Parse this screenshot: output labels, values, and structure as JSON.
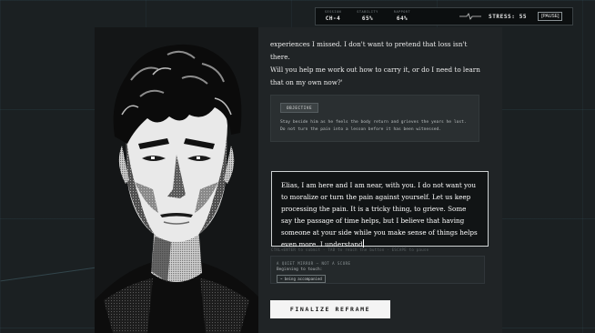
{
  "hud": {
    "session_label": "SESSION",
    "session_value": "CH-4",
    "stability_label": "STABILITY",
    "stability_value": "65%",
    "rapport_label": "RAPPORT",
    "rapport_value": "64%",
    "stress_label": "STRESS: 55",
    "pause_label": "[PAUSE]",
    "pulse_icon": "heartbeat-icon"
  },
  "story": {
    "lines": [
      "experiences I missed. I don't want to pretend that loss isn't there.",
      "Will you help me work out how to carry it, or do I need to learn",
      "that on my own now?'"
    ]
  },
  "objective": {
    "tag": "OBJECTIVE",
    "text": "Stay beside him as he feels the body return and grieves the years he lost. Do not turn the pain into a lesson before it has been witnessed."
  },
  "response": {
    "text": "Elias, I am here and I am near, with you. I do not want you to moralize or turn the pain against yourself. Let us keep processing the pain. It is a tricky thing, to grieve. Some say the passage of time helps, but I believe that having someone at your side while you make sense of things helps even more. I understand"
  },
  "hint": "CTRL+ENTER to submit · TAB to reach the button · ESCAPE to pause",
  "mirror": {
    "title": "A QUIET MIRROR — NOT A SCORE",
    "subtitle": "Beginning to touch:",
    "chip": "~ being accompanied"
  },
  "finalize_label": "FINALIZE REFRAME",
  "colors": {
    "background": "#1b2022",
    "panel": "#202426",
    "accent": "#f4f4f4"
  }
}
